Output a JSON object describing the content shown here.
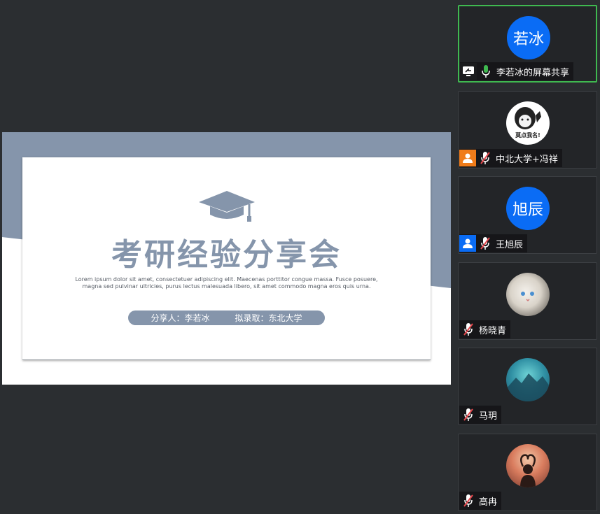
{
  "slide": {
    "title": "考研经验分享会",
    "lorem_line1": "Lorem ipsum dolor sit amet, consectetuer adipiscing elit. Maecenas porttitor congue massa. Fusce posuere,",
    "lorem_line2": "magna sed pulvinar ultricies, purus lectus malesuada libero, sit amet commodo magna eros quis urna.",
    "presenter": "分享人：李若冰",
    "target": "拟录取：东北大学"
  },
  "participants": [
    {
      "name": "李若冰的屏幕共享",
      "avatar_text": "若冰",
      "status": "mic-on",
      "badge": "screen-share-icon"
    },
    {
      "name": "中北大学+冯祥",
      "avatar_text": "",
      "avatar_caption": "莫点我名!",
      "status": "mic-muted",
      "badge": "user-icon"
    },
    {
      "name": "王旭辰",
      "avatar_text": "旭辰",
      "status": "mic-muted",
      "badge": "user-icon"
    },
    {
      "name": "杨晓青",
      "avatar_text": "",
      "status": "mic-muted",
      "badge": ""
    },
    {
      "name": "马玥",
      "avatar_text": "",
      "status": "mic-muted",
      "badge": ""
    },
    {
      "name": "高冉",
      "avatar_text": "",
      "status": "mic-muted",
      "badge": ""
    }
  ],
  "colors": {
    "background": "#2b2e31",
    "slide_accent": "#8595ab",
    "avatar_blue": "#0a6cf5",
    "active_border": "#3fb950",
    "mic_on": "#3fb950",
    "muted_red": "#e5484d",
    "badge_orange": "#f07c1a"
  }
}
